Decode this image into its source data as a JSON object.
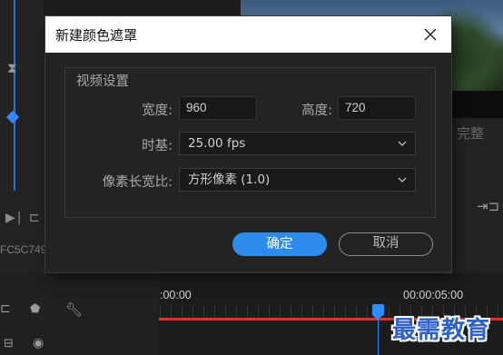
{
  "dialog": {
    "title": "新建颜色遮罩",
    "group_label": "视频设置",
    "width_label": "宽度:",
    "width_value": "960",
    "height_label": "高度:",
    "height_value": "720",
    "timebase_label": "时基:",
    "timebase_value": "25.00 fps",
    "pixel_aspect_label": "像素长宽比:",
    "pixel_aspect_value": "方形像素 (1.0)",
    "ok_label": "确定",
    "cancel_label": "取消"
  },
  "background": {
    "clip_code": "FC5C749",
    "right_label": "完整",
    "timeline_start": ":00:00",
    "timeline_end": "00:00:05:00",
    "watermark": "最需教育"
  },
  "colors": {
    "accent": "#2d8ceb",
    "playhead": "#2f8cff",
    "work_area": "#e0302b"
  },
  "icons": [
    "close-icon",
    "chevron-down-icon",
    "wrench-icon",
    "marker-icon",
    "eye-icon"
  ]
}
